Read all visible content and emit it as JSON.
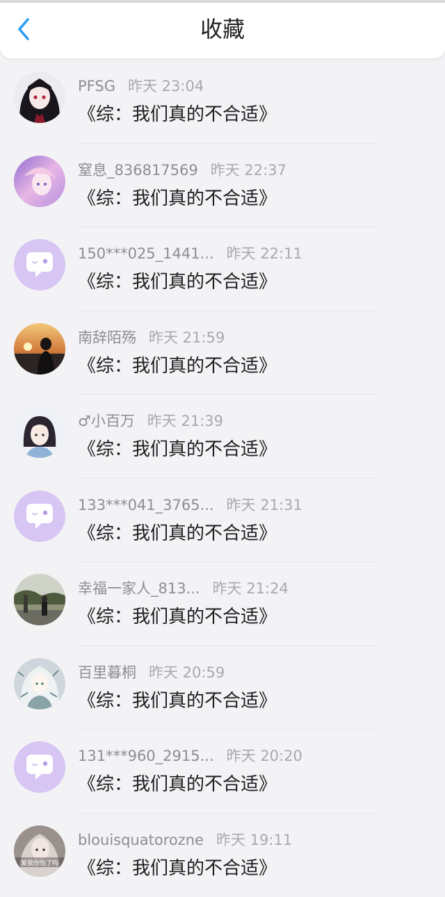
{
  "header": {
    "title": "收藏",
    "back_icon": "chevron-left-icon",
    "accent_color": "#2a9df4"
  },
  "items": [
    {
      "name": "PFSG",
      "time": "昨天 23:04",
      "book": "《综：我们真的不合适》",
      "avatar": "dark-hair-girl"
    },
    {
      "name": "窒息_836817569",
      "time": "昨天 22:37",
      "book": "《综：我们真的不合适》",
      "avatar": "pink-anime-girl"
    },
    {
      "name": "150***025_1441...",
      "time": "昨天 22:11",
      "book": "《综：我们真的不合适》",
      "avatar": "default-chat-bubble"
    },
    {
      "name": "南辞陌殇",
      "time": "昨天 21:59",
      "book": "《综：我们真的不合适》",
      "avatar": "sunset-man"
    },
    {
      "name": "♂小百万",
      "time": "昨天 21:39",
      "book": "《综：我们真的不合适》",
      "avatar": "short-hair-girl"
    },
    {
      "name": "133***041_3765...",
      "time": "昨天 21:31",
      "book": "《综：我们真的不合适》",
      "avatar": "default-chat-bubble"
    },
    {
      "name": "幸福一家人_813...",
      "time": "昨天 21:24",
      "book": "《综：我们真的不合适》",
      "avatar": "outdoor-man"
    },
    {
      "name": "百里暮桐",
      "time": "昨天 20:59",
      "book": "《综：我们真的不合适》",
      "avatar": "silver-hair-girl"
    },
    {
      "name": "131***960_2915...",
      "time": "昨天 20:20",
      "book": "《综：我们真的不合适》",
      "avatar": "default-chat-bubble"
    },
    {
      "name": "blouisquatorozne",
      "time": "昨天 19:11",
      "book": "《综：我们真的不合适》",
      "avatar": "girl-photo",
      "avatar_caption": "爱我你怕了吗"
    }
  ]
}
